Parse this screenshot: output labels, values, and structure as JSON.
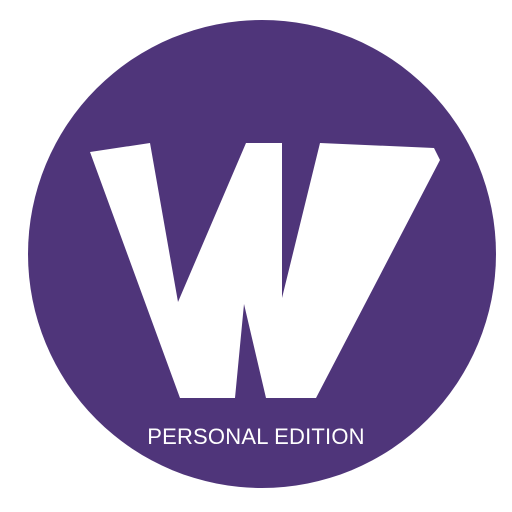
{
  "logo": {
    "letter": "W",
    "edition_label": "PERSONAL EDITION"
  },
  "colors": {
    "background": "#ffffff",
    "circle": "#4f357a",
    "mark": "#ffffff"
  },
  "icons": {
    "logo_mark": "w-letter-logo-icon"
  }
}
